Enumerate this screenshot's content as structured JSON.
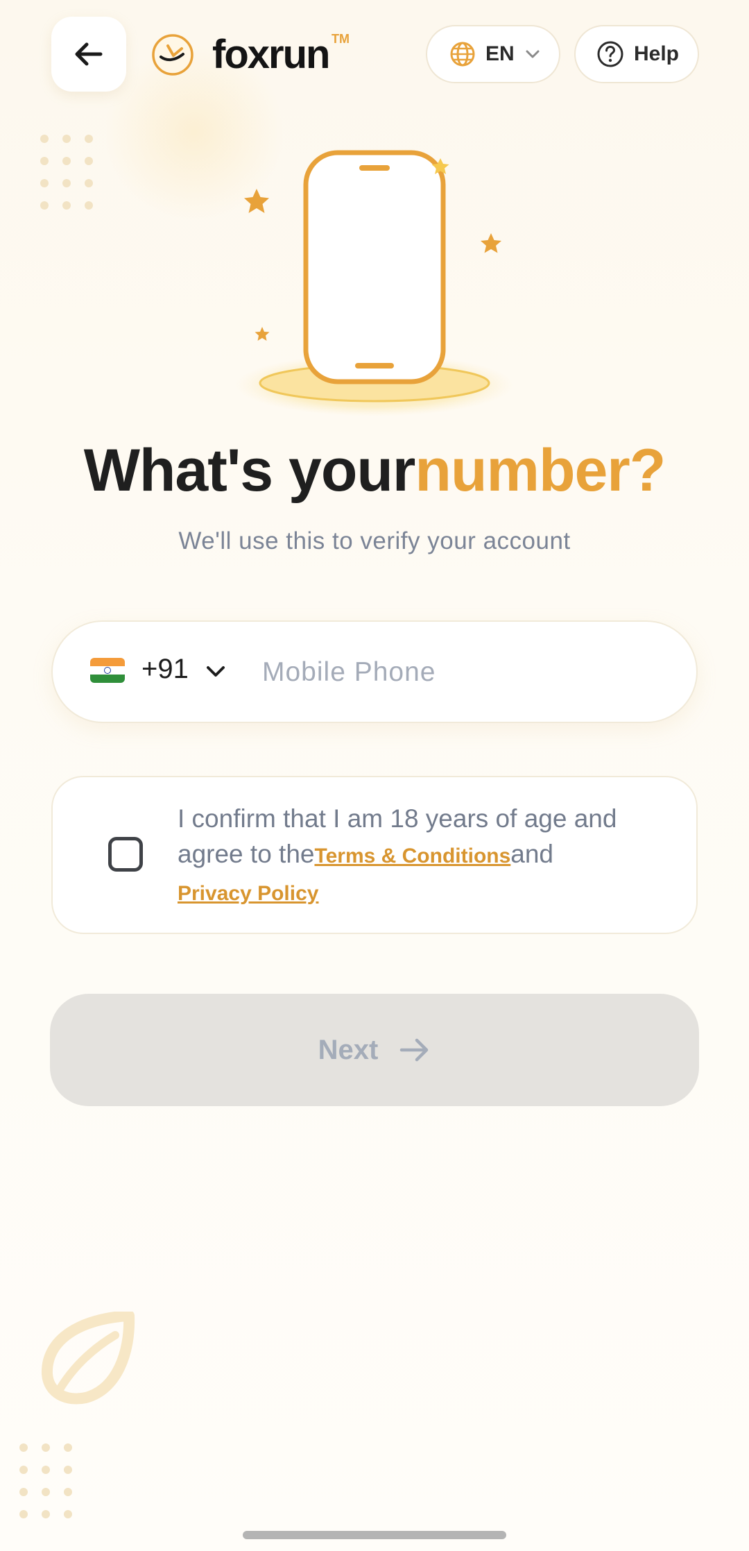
{
  "header": {
    "brand_name": "foxrun",
    "brand_tm": "TM",
    "language_label": "EN",
    "help_label": "Help"
  },
  "main": {
    "title_part1": "What's your",
    "title_part2": "number?",
    "subtitle": "We'll use this to verify your account"
  },
  "phone": {
    "country_code": "+91",
    "country_flag": "india-flag",
    "value": "",
    "placeholder": "Mobile Phone"
  },
  "consent": {
    "checked": false,
    "text_part1": "I confirm that I am 18 years of age and agree to the",
    "terms_link": "Terms & Conditions",
    "text_part2": "and",
    "privacy_link": "Privacy Policy"
  },
  "actions": {
    "next_label": "Next",
    "next_enabled": false
  },
  "colors": {
    "accent": "#e8a23a",
    "link": "#d8952f",
    "disabled_button": "#e4e2de",
    "muted_text": "#7b8496"
  }
}
